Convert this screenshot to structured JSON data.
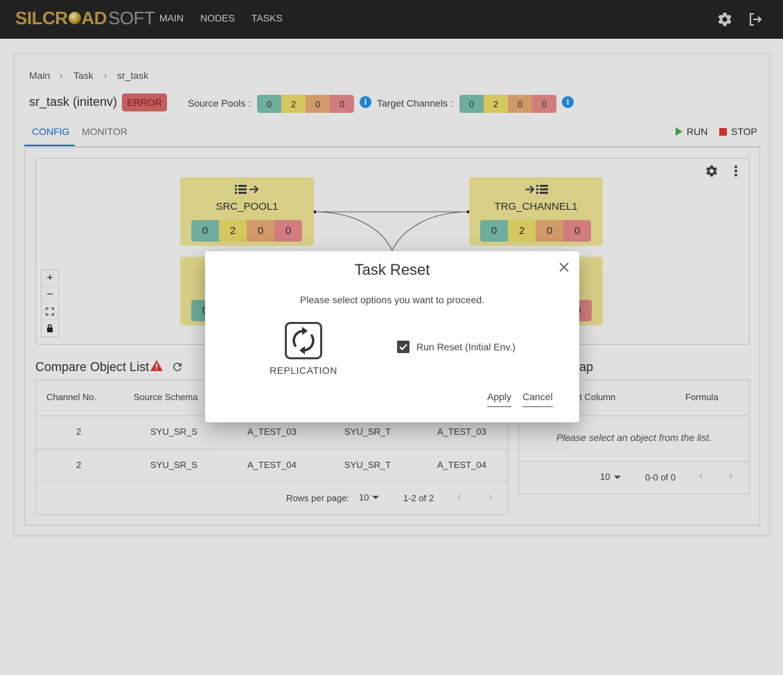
{
  "app": {
    "logo_main": "SILCR",
    "logo_mid": "AD",
    "logo_soft": "SOFT",
    "nav": [
      "MAIN",
      "NODES",
      "TASKS"
    ]
  },
  "breadcrumb": [
    "Main",
    "Task",
    "sr_task"
  ],
  "task": {
    "title": "sr_task (initenv)",
    "status": "ERROR",
    "source_pools_label": "Source Pools :",
    "source_pools": [
      "0",
      "2",
      "0",
      "0"
    ],
    "target_channels_label": "Target Channels :",
    "target_channels": [
      "0",
      "2",
      "0",
      "0"
    ]
  },
  "tabs": [
    "CONFIG",
    "MONITOR"
  ],
  "actions": {
    "run": "RUN",
    "stop": "STOP"
  },
  "diagram": {
    "nodes": [
      {
        "name": "SRC_POOL1",
        "counts": [
          "0",
          "2",
          "0",
          "0"
        ]
      },
      {
        "name": "TRG_CHANNEL1",
        "counts": [
          "0",
          "2",
          "0",
          "0"
        ]
      }
    ],
    "partial_left_count": "0",
    "partial_right_count": "0",
    "zoom_controls": [
      "+",
      "−"
    ]
  },
  "compare_list": {
    "title": "Compare Object List",
    "columns": [
      "Channel No.",
      "Source Schema"
    ],
    "rows": [
      [
        "2",
        "SYU_SR_S",
        "A_TEST_03",
        "SYU_SR_T",
        "A_TEST_03"
      ],
      [
        "2",
        "SYU_SR_S",
        "A_TEST_04",
        "SYU_SR_T",
        "A_TEST_04"
      ]
    ],
    "rows_per_page_label": "Rows per page:",
    "rows_per_page": "10",
    "range": "1-2 of 2"
  },
  "map_panel": {
    "title_fragment": "ap",
    "columns": [
      "et Column",
      "Formula"
    ],
    "empty": "Please select an object from the list.",
    "rows_per_page": "10",
    "range": "0-0 of 0"
  },
  "modal": {
    "title": "Task Reset",
    "message": "Please select options you want to proceed.",
    "option_label": "REPLICATION",
    "checkbox_label": "Run Reset (Initial Env.)",
    "apply": "Apply",
    "cancel": "Cancel"
  }
}
